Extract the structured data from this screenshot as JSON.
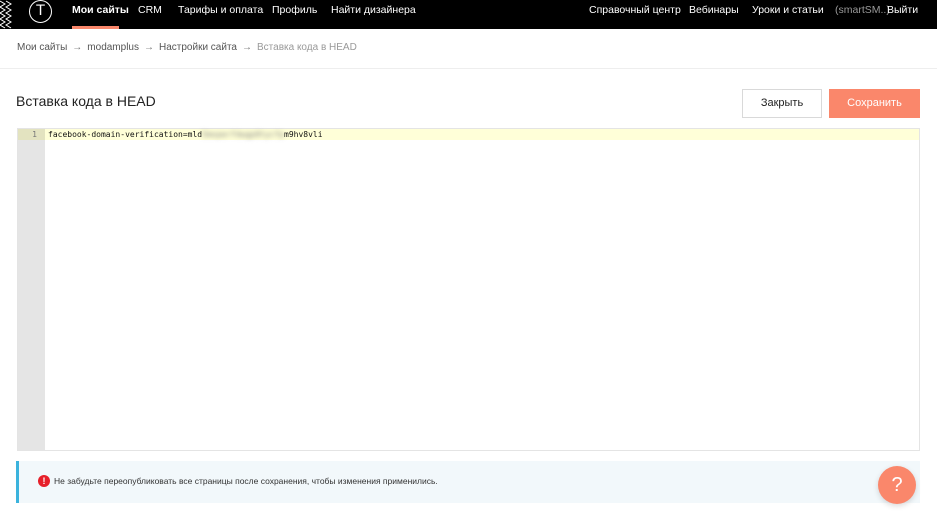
{
  "nav": {
    "logo_letter": "T",
    "left": [
      {
        "label": "Мои сайты",
        "active": true
      },
      {
        "label": "CRM"
      },
      {
        "label": "Тарифы и оплата"
      },
      {
        "label": "Профиль"
      },
      {
        "label": "Найти дизайнера"
      }
    ],
    "right": {
      "help": "Справочный центр",
      "webinars": "Вебинары",
      "lessons": "Уроки и статьи",
      "user": "(smartSM..)",
      "logout": "Выйти"
    }
  },
  "breadcrumb": {
    "items": [
      "Мои сайты",
      "modamplus",
      "Настройки сайта",
      "Вставка кода в HEAD"
    ],
    "separator": "→"
  },
  "page": {
    "title": "Вставка кода в HEAD",
    "close_label": "Закрыть",
    "save_label": "Сохранить"
  },
  "editor": {
    "line_number": "1",
    "code_prefix": "facebook-domain-verification=mld",
    "code_redacted": "5mxperfdwgp0tycfp",
    "code_suffix": "m9hv8vli"
  },
  "notice": {
    "icon": "!",
    "text": "Не забудьте переопубликовать все страницы после сохранения, чтобы изменения применились."
  },
  "help": {
    "icon": "?"
  },
  "colors": {
    "accent": "#fa876b",
    "notice_bar": "#3bb3dd",
    "error": "#e6202a"
  }
}
